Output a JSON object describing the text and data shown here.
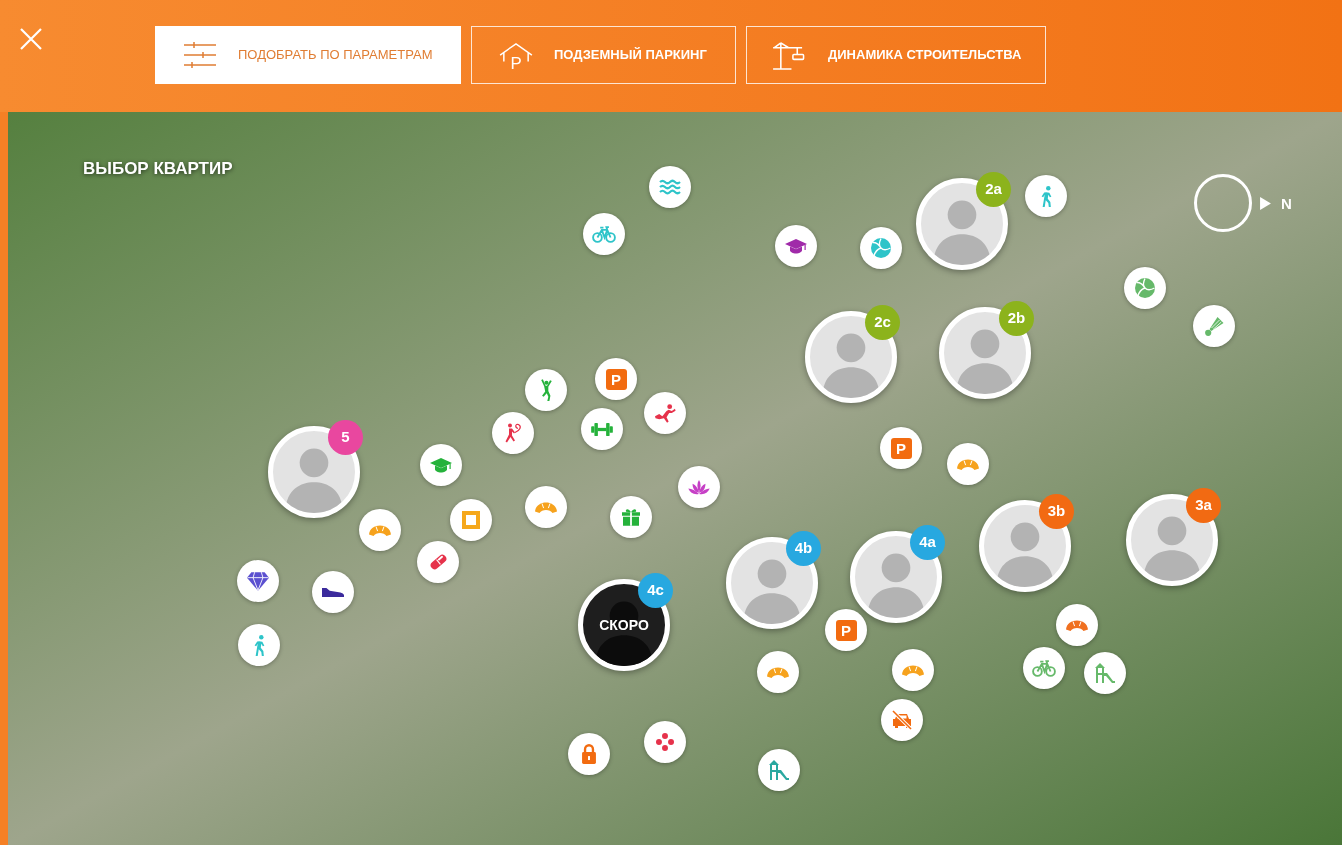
{
  "toolbar": [
    {
      "label": "ПОДОБРАТЬ ПО ПАРАМЕТРАМ",
      "selected": true
    },
    {
      "label": "ПОДЗЕМНЫЙ ПАРКИНГ",
      "selected": false,
      "icon_text": "P"
    },
    {
      "label": "ДИНАМИКА СТРОИТЕЛЬСТВА",
      "selected": false
    }
  ],
  "map": {
    "title": "ВЫБОР КВАРТИР",
    "compass": {
      "label": "N"
    },
    "buildings": [
      {
        "kind": "portrait",
        "label": "2a",
        "color": "#8cb31c"
      },
      {
        "kind": "portrait",
        "label": "2b",
        "color": "#8cb31c"
      },
      {
        "kind": "portrait",
        "label": "2c",
        "color": "#8cb31c"
      },
      {
        "kind": "portrait",
        "label": "5",
        "color": "#e9479f"
      },
      {
        "kind": "portrait",
        "label": "3a",
        "color": "#f26a12"
      },
      {
        "kind": "portrait",
        "label": "3b",
        "color": "#f26a12"
      },
      {
        "kind": "portrait",
        "label": "4a",
        "color": "#27a8e0"
      },
      {
        "kind": "portrait",
        "label": "4b",
        "color": "#27a8e0"
      },
      {
        "kind": "coming_soon",
        "label": "4c",
        "color": "#27a8e0",
        "caption": "СКОРО"
      }
    ],
    "markers": [
      {
        "kind": "waves",
        "color": "#2ec4c9"
      },
      {
        "kind": "walk",
        "color": "#2ec4c9"
      },
      {
        "kind": "bicycle",
        "color": "#2ec4c9"
      },
      {
        "kind": "cap",
        "color": "#a02aa9"
      },
      {
        "kind": "ball",
        "color": "#2ec4c9"
      },
      {
        "kind": "ball",
        "color": "#66b96a"
      },
      {
        "kind": "shuttlecock",
        "color": "#66b96a"
      },
      {
        "kind": "parking",
        "color": "#f26b10",
        "label": "P"
      },
      {
        "kind": "jump",
        "color": "#25b23b"
      },
      {
        "kind": "climb",
        "color": "#e6324b"
      },
      {
        "kind": "dumbbell",
        "color": "#25b23b"
      },
      {
        "kind": "gymnast",
        "color": "#e6324b"
      },
      {
        "kind": "parking",
        "color": "#f26b10",
        "label": "P"
      },
      {
        "kind": "cap",
        "color": "#25b23b"
      },
      {
        "kind": "croissant",
        "color": "#f6a21d"
      },
      {
        "kind": "lotus",
        "color": "#c63fc6"
      },
      {
        "kind": "croissant",
        "color": "#f6a21d"
      },
      {
        "kind": "gift",
        "color": "#25b23b"
      },
      {
        "kind": "frame",
        "color": "#f5a81c"
      },
      {
        "kind": "croissant",
        "color": "#f6a21d"
      },
      {
        "kind": "pill",
        "color": "#e6324b"
      },
      {
        "kind": "diamond",
        "color": "#5b50d0"
      },
      {
        "kind": "shoe",
        "color": "#3b2a9c"
      },
      {
        "kind": "croissant",
        "color": "#f07020"
      },
      {
        "kind": "parking",
        "color": "#f26b10",
        "label": "P"
      },
      {
        "kind": "walk",
        "color": "#2ec4c9"
      },
      {
        "kind": "bicycle",
        "color": "#66b96a"
      },
      {
        "kind": "croissant",
        "color": "#f6a21d"
      },
      {
        "kind": "croissant",
        "color": "#f6a21d"
      },
      {
        "kind": "playground",
        "color": "#66b96a"
      },
      {
        "kind": "nocar",
        "color": "#f26b10"
      },
      {
        "kind": "flower",
        "color": "#e6324b"
      },
      {
        "kind": "lock",
        "color": "#f26b10"
      },
      {
        "kind": "playground",
        "color": "#2aa8a0"
      }
    ]
  }
}
